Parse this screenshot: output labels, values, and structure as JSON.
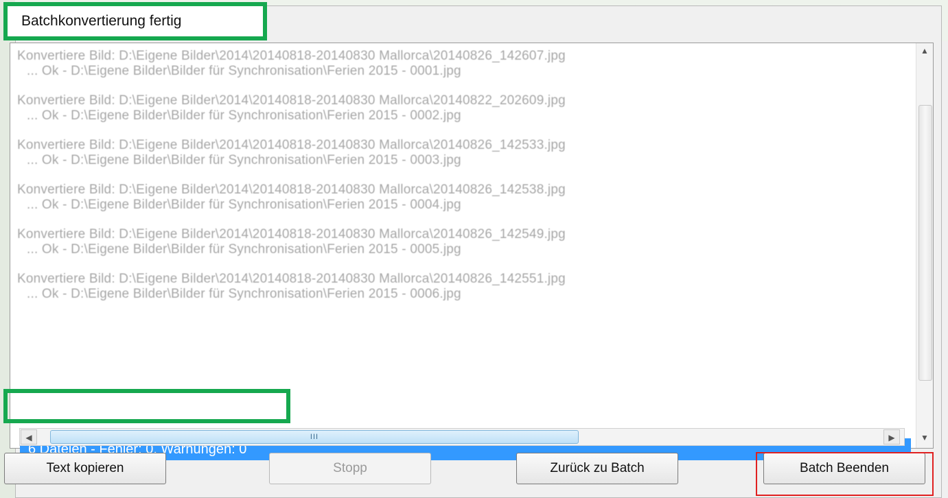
{
  "window": {
    "title": "Batchkonvertierung fertig"
  },
  "log": {
    "entries": [
      {
        "line1": "Konvertiere Bild: D:\\Eigene Bilder\\2014\\20140818-20140830 Mallorca\\20140826_142607.jpg",
        "line2": "... Ok - D:\\Eigene Bilder\\Bilder für Synchronisation\\Ferien 2015 - 0001.jpg"
      },
      {
        "line1": "Konvertiere Bild: D:\\Eigene Bilder\\2014\\20140818-20140830 Mallorca\\20140822_202609.jpg",
        "line2": "... Ok - D:\\Eigene Bilder\\Bilder für Synchronisation\\Ferien 2015 - 0002.jpg"
      },
      {
        "line1": "Konvertiere Bild: D:\\Eigene Bilder\\2014\\20140818-20140830 Mallorca\\20140826_142533.jpg",
        "line2": "... Ok - D:\\Eigene Bilder\\Bilder für Synchronisation\\Ferien 2015 - 0003.jpg"
      },
      {
        "line1": "Konvertiere Bild: D:\\Eigene Bilder\\2014\\20140818-20140830 Mallorca\\20140826_142538.jpg",
        "line2": "... Ok - D:\\Eigene Bilder\\Bilder für Synchronisation\\Ferien 2015 - 0004.jpg"
      },
      {
        "line1": "Konvertiere Bild: D:\\Eigene Bilder\\2014\\20140818-20140830 Mallorca\\20140826_142549.jpg",
        "line2": "... Ok - D:\\Eigene Bilder\\Bilder für Synchronisation\\Ferien 2015 - 0005.jpg"
      },
      {
        "line1": "Konvertiere Bild: D:\\Eigene Bilder\\2014\\20140818-20140830 Mallorca\\20140826_142551.jpg",
        "line2": "... Ok - D:\\Eigene Bilder\\Bilder für Synchronisation\\Ferien 2015 - 0006.jpg"
      }
    ]
  },
  "status": {
    "summary": "6 Dateien - Fehler: 0, Warnungen: 0"
  },
  "hscroll": {
    "thumb_grip": "III"
  },
  "buttons": {
    "copy": "Text kopieren",
    "stop": "Stopp",
    "back": "Zurück zu Batch",
    "finish": "Batch Beenden"
  },
  "icons": {
    "scroll_up": "scroll-up-icon",
    "scroll_down": "scroll-down-icon",
    "scroll_left": "scroll-left-icon",
    "scroll_right": "scroll-right-icon"
  },
  "colors": {
    "highlight_green": "#16a84f",
    "highlight_red": "#e02020",
    "selection_blue": "#3399ff"
  }
}
